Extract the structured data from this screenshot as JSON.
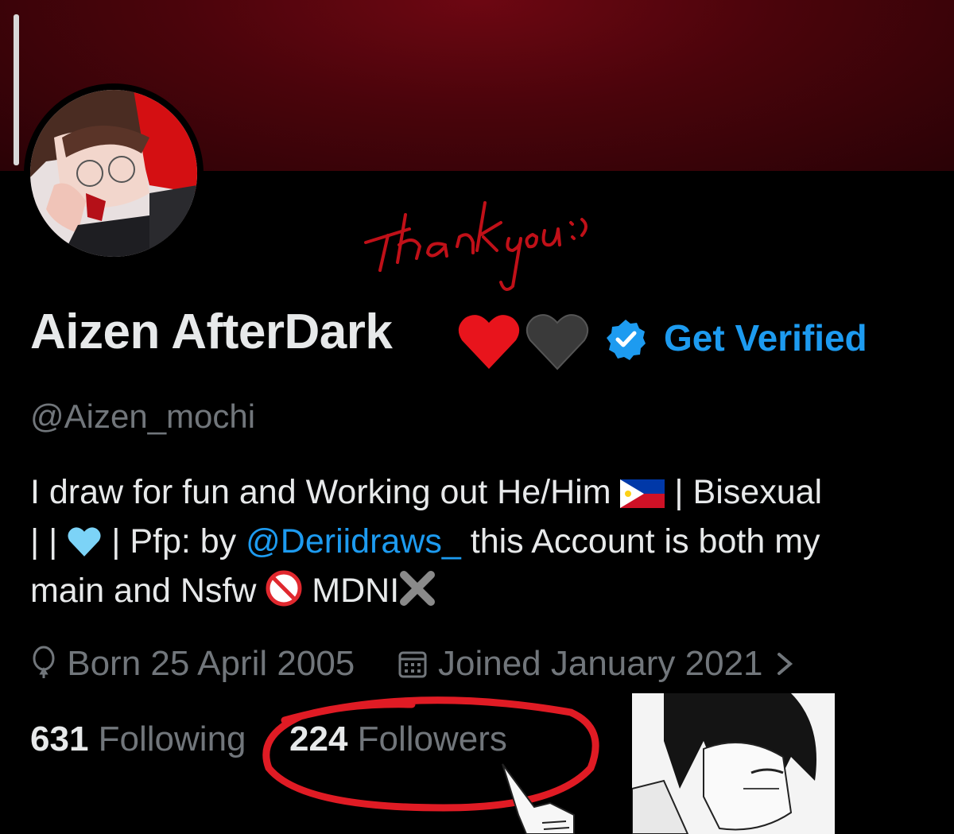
{
  "profile": {
    "display_name": "Aizen AfterDark",
    "handle": "@Aizen_mochi",
    "get_verified_label": "Get Verified",
    "name_emoji": [
      "red-heart",
      "black-heart"
    ]
  },
  "bio": {
    "line1_text": "I draw for fun and Working out   He/Him",
    "line1_after_flag": " | Bisexual",
    "line2_start": "|  |",
    "line2_mid": " | Pfp: by ",
    "mention": "@Deriidraws_",
    "line2_end": " this Account is both my",
    "line3_start": "main and Nsfw ",
    "line3_end": " MDNI",
    "emojis": [
      "philippines-flag",
      "light-blue-heart",
      "no-under-18",
      "cross-mark"
    ]
  },
  "meta": {
    "born": "Born 25 April 2005",
    "joined": "Joined January 2021"
  },
  "stats": {
    "following_count": "631",
    "following_label": "Following",
    "followers_count": "224",
    "followers_label": "Followers"
  },
  "annotations": {
    "handwritten_text": [
      "Thank",
      "you:>"
    ],
    "circle_color": "#e01b24"
  },
  "colors": {
    "accent": "#1d9bf0",
    "secondary_text": "#71767b",
    "banner": "#5a0510"
  }
}
